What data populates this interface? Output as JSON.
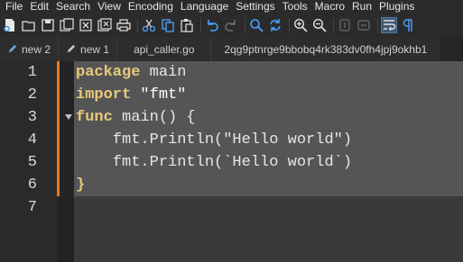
{
  "menu": [
    "File",
    "Edit",
    "Search",
    "View",
    "Encoding",
    "Language",
    "Settings",
    "Tools",
    "Macro",
    "Run",
    "Plugins"
  ],
  "toolbar_icons": [
    "new-file-icon",
    "open-file-icon",
    "save-icon",
    "save-all-icon",
    "close-icon",
    "close-all-icon",
    "print-icon",
    "cut-icon",
    "copy-icon",
    "paste-icon",
    "undo-icon",
    "redo-icon",
    "find-icon",
    "replace-icon",
    "zoom-in-icon",
    "zoom-out-icon",
    "sync-vertical-icon",
    "sync-horizontal-icon",
    "word-wrap-icon",
    "show-all-chars-icon"
  ],
  "tabs": [
    {
      "label": "new 2",
      "modified": true
    },
    {
      "label": "new 1",
      "modified": true
    },
    {
      "label": "api_caller.go",
      "modified": false
    },
    {
      "label": "2qg9ptnrge9bbobq4rk383dv0fh4jpj9okhb1",
      "modified": false
    }
  ],
  "lines": [
    {
      "num": "1",
      "tokens": [
        {
          "t": "package",
          "c": "kw"
        },
        {
          "t": " main",
          "c": "plain"
        }
      ]
    },
    {
      "num": "2",
      "tokens": [
        {
          "t": "import",
          "c": "kw"
        },
        {
          "t": " \"fmt\"",
          "c": "str"
        }
      ]
    },
    {
      "num": "3",
      "tokens": [
        {
          "t": "func",
          "c": "kw"
        },
        {
          "t": " main() {",
          "c": "plain"
        }
      ]
    },
    {
      "num": "4",
      "tokens": [
        {
          "t": "    fmt.Println(\"Hello world\")",
          "c": "plain"
        }
      ]
    },
    {
      "num": "5",
      "tokens": [
        {
          "t": "    fmt.Println(`Hello world`)",
          "c": "plain"
        }
      ]
    },
    {
      "num": "6",
      "tokens": [
        {
          "t": "}",
          "c": "kw"
        }
      ]
    },
    {
      "num": "7",
      "tokens": []
    }
  ],
  "colors": {
    "keyword": "#e8c97a",
    "change_marker": "#e07b22",
    "selection": "#555555"
  }
}
